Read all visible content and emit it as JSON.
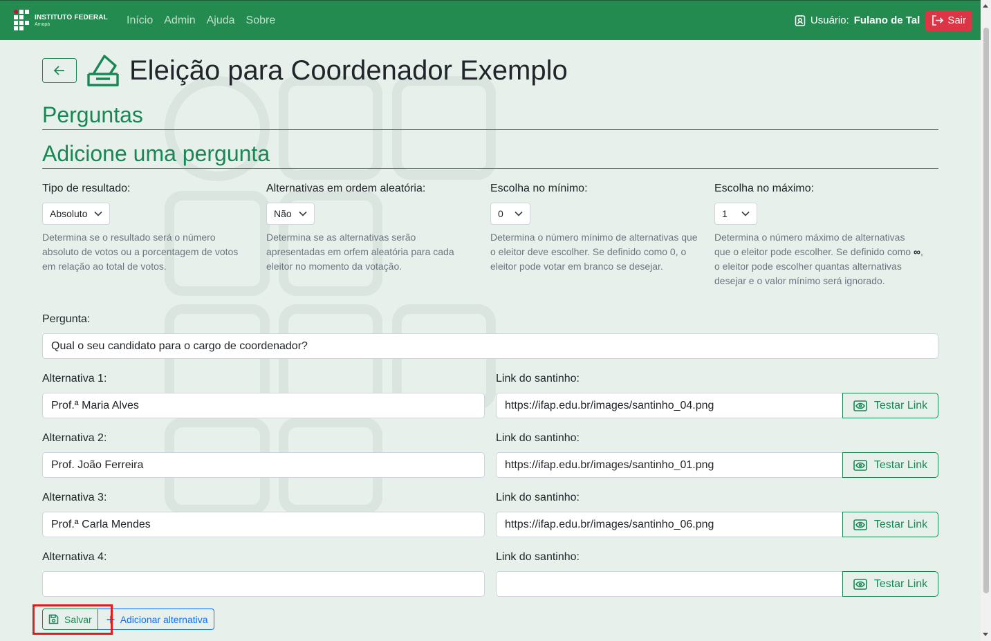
{
  "navbar": {
    "brand_name": "INSTITUTO FEDERAL",
    "brand_campus": "Amapá",
    "links": [
      "Início",
      "Admin",
      "Ajuda",
      "Sobre"
    ],
    "user_prefix": "Usuário:",
    "user_name": "Fulano de Tal",
    "logout_label": "Sair"
  },
  "page": {
    "title": "Eleição para Coordenador Exemplo",
    "section_questions": "Perguntas",
    "section_add": "Adicione uma pergunta"
  },
  "settings": [
    {
      "label": "Tipo de resultado:",
      "value": "Absoluto",
      "help": "Determina se o resultado será o número absoluto de votos ou a porcentagem de votos em relação ao total de votos."
    },
    {
      "label": "Alternativas em ordem aleatória:",
      "value": "Não",
      "help": "Determina se as alternativas serão apresentadas em orfem aleatória para cada eleitor no momento da votação."
    },
    {
      "label": "Escolha no mínimo:",
      "value": "0",
      "help": "Determina o número mínimo de alternativas que o eleitor deve escolher. Se definido como 0, o eleitor pode votar em branco se desejar."
    },
    {
      "label": "Escolha no máximo:",
      "value": "1",
      "help_before": "Determina o número máximo de alternativas que o eleitor pode escolher. Se definido como",
      "help_symbol": "∞",
      "help_after": ", o eleitor pode escolher quantas alternativas desejar e o valor mínimo será ignorado."
    }
  ],
  "question": {
    "label": "Pergunta:",
    "value": "Qual o seu candidato para o cargo de coordenador?"
  },
  "alternatives": [
    {
      "label": "Alternativa 1:",
      "value": "Prof.ª Maria Alves",
      "link_label": "Link do santinho:",
      "link": "https://ifap.edu.br/images/santinho_04.png"
    },
    {
      "label": "Alternativa 2:",
      "value": "Prof. João Ferreira",
      "link_label": "Link do santinho:",
      "link": "https://ifap.edu.br/images/santinho_01.png"
    },
    {
      "label": "Alternativa 3:",
      "value": "Prof.ª Carla Mendes",
      "link_label": "Link do santinho:",
      "link": "https://ifap.edu.br/images/santinho_06.png"
    },
    {
      "label": "Alternativa 4:",
      "value": "",
      "link_label": "Link do santinho:",
      "link": ""
    }
  ],
  "buttons": {
    "test_link": "Testar Link",
    "save": "Salvar",
    "add_alternative": "Adicionar alternativa"
  },
  "colors": {
    "navbar": "#238b4f",
    "primary_green": "#198754",
    "danger": "#dc3545",
    "link_blue": "#0d6efd",
    "highlight_box": "#e8191b"
  }
}
